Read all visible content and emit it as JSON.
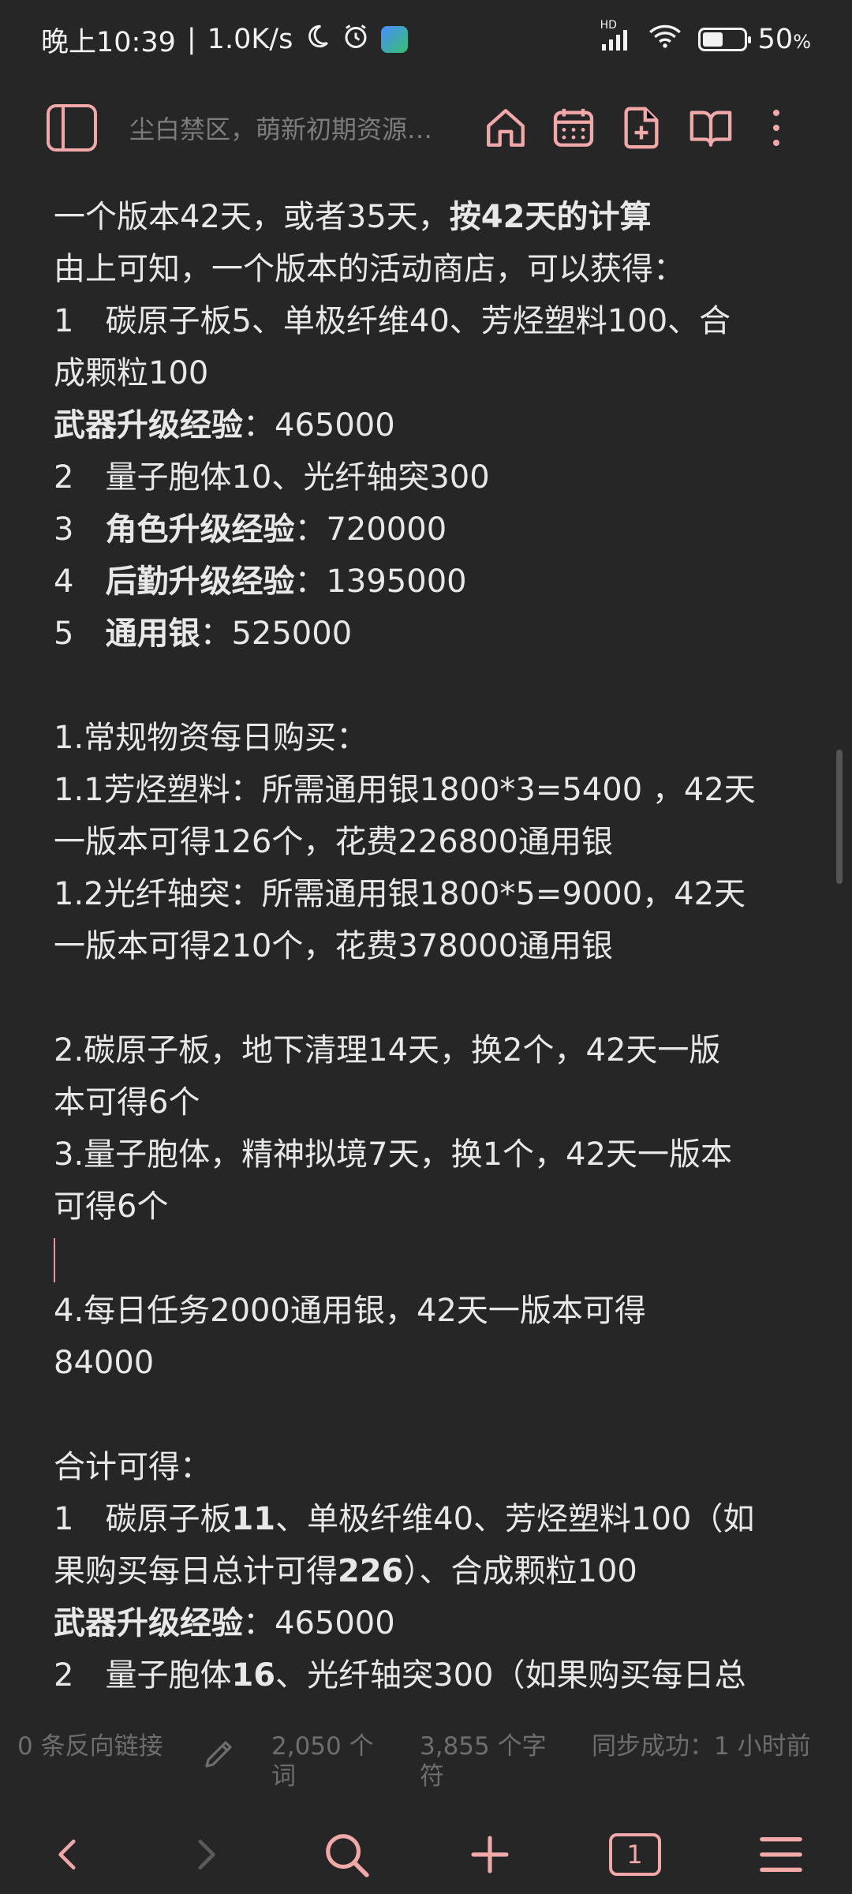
{
  "status_bar": {
    "time": "晚上10:39",
    "separator": "|",
    "speed": "1.0K/s",
    "network_badge": "HD",
    "battery_percent": "50",
    "battery_unit": "%",
    "battery_level": 0.5
  },
  "toolbar": {
    "title": "尘白禁区，萌新初期资源…"
  },
  "content": {
    "lines": [
      {
        "segments": [
          {
            "t": "一个版本42天，或者35天，"
          },
          {
            "t": "按42天的计算",
            "b": true
          }
        ]
      },
      {
        "segments": [
          {
            "t": "由上可知，一个版本的活动商店，可以获得："
          }
        ]
      },
      {
        "segments": [
          {
            "t": "1　碳原子板5、单极纤维40、芳烃塑料100、合"
          }
        ]
      },
      {
        "segments": [
          {
            "t": "成颗粒100"
          }
        ]
      },
      {
        "segments": [
          {
            "t": "武器升级经验",
            "b": true
          },
          {
            "t": "：465000"
          }
        ]
      },
      {
        "segments": [
          {
            "t": "2　量子胞体10、光纤轴突300"
          }
        ]
      },
      {
        "segments": [
          {
            "t": "3　"
          },
          {
            "t": "角色升级经验",
            "b": true
          },
          {
            "t": "：720000"
          }
        ]
      },
      {
        "segments": [
          {
            "t": "4　"
          },
          {
            "t": "后勤升级经验",
            "b": true
          },
          {
            "t": "：1395000"
          }
        ]
      },
      {
        "segments": [
          {
            "t": "5　"
          },
          {
            "t": "通用银",
            "b": true
          },
          {
            "t": "：525000"
          }
        ]
      },
      {
        "blank": true
      },
      {
        "segments": [
          {
            "t": "1.常规物资每日购买："
          }
        ]
      },
      {
        "segments": [
          {
            "t": "1.1芳烃塑料：所需通用银1800*3=5400 ，42天"
          }
        ]
      },
      {
        "segments": [
          {
            "t": "一版本可得126个，花费226800通用银"
          }
        ]
      },
      {
        "segments": [
          {
            "t": "1.2光纤轴突：所需通用银1800*5=9000，42天"
          }
        ]
      },
      {
        "segments": [
          {
            "t": "一版本可得210个，花费378000通用银"
          }
        ]
      },
      {
        "blank": true
      },
      {
        "segments": [
          {
            "t": "2.碳原子板，地下清理14天，换2个，42天一版"
          }
        ]
      },
      {
        "segments": [
          {
            "t": "本可得6个"
          }
        ]
      },
      {
        "segments": [
          {
            "t": "3.量子胞体，精神拟境7天，换1个，42天一版本"
          }
        ]
      },
      {
        "segments": [
          {
            "t": "可得6个"
          }
        ]
      },
      {
        "cursor": true
      },
      {
        "segments": [
          {
            "t": "4.每日任务2000通用银，42天一版本可得"
          }
        ]
      },
      {
        "segments": [
          {
            "t": "84000"
          }
        ]
      },
      {
        "blank": true
      },
      {
        "segments": [
          {
            "t": "合计可得："
          }
        ]
      },
      {
        "segments": [
          {
            "t": "1　碳原子板"
          },
          {
            "t": "11",
            "b": true
          },
          {
            "t": "、单极纤维40、芳烃塑料100（如"
          }
        ]
      },
      {
        "segments": [
          {
            "t": "果购买每日总计可得"
          },
          {
            "t": "226",
            "b": true
          },
          {
            "t": "）、合成颗粒100"
          }
        ]
      },
      {
        "segments": [
          {
            "t": "武器升级经验",
            "b": true
          },
          {
            "t": "：465000"
          }
        ]
      },
      {
        "segments": [
          {
            "t": "2　量子胞体"
          },
          {
            "t": "16",
            "b": true
          },
          {
            "t": "、光纤轴突300（如果购买每日总"
          }
        ]
      }
    ]
  },
  "info_bar": {
    "backlinks": "0 条反向链接",
    "words": "2,050 个词",
    "chars": "3,855 个字符",
    "sync": "同步成功：1 小时前"
  },
  "bottom_nav": {
    "tab_count": "1"
  },
  "colors": {
    "background": "#262626",
    "accent": "#f0a8a8",
    "text": "#e8e8e8",
    "muted": "#7d7d7d"
  }
}
